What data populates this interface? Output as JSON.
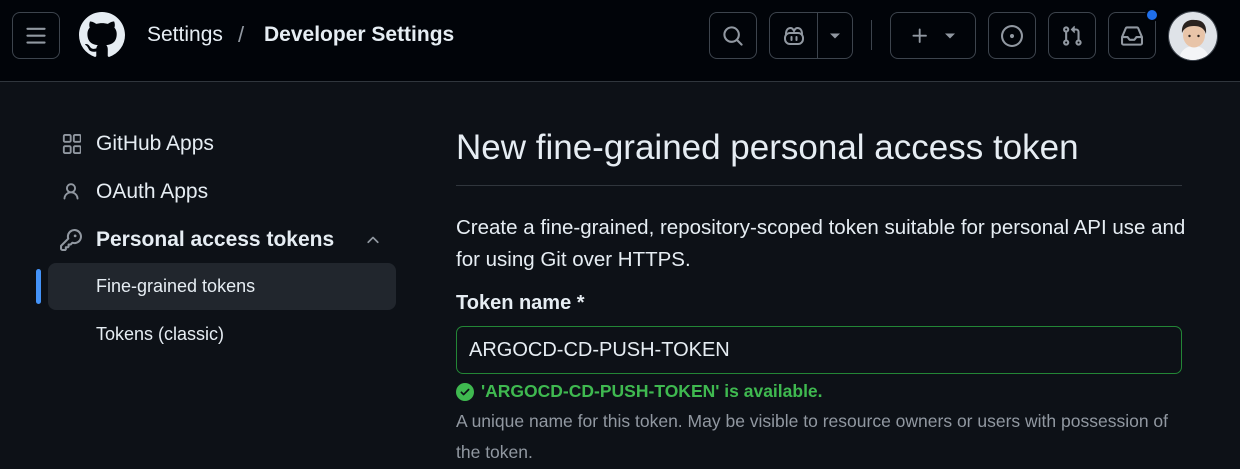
{
  "header": {
    "breadcrumb_settings": "Settings",
    "breadcrumb_separator": "/",
    "breadcrumb_current": "Developer Settings",
    "icons": [
      "hamburger-icon",
      "github-logo-icon",
      "search-icon",
      "copilot-icon",
      "chevron-down-icon",
      "plus-icon",
      "issue-opened-icon",
      "git-pull-request-icon",
      "inbox-icon"
    ],
    "has_notifications": true
  },
  "sidebar": {
    "items": [
      {
        "label": "GitHub Apps",
        "icon": "apps-icon"
      },
      {
        "label": "OAuth Apps",
        "icon": "person-icon"
      },
      {
        "label": "Personal access tokens",
        "icon": "key-icon",
        "expanded": true
      },
      {
        "label": "Fine-grained tokens",
        "selected": true
      },
      {
        "label": "Tokens (classic)"
      }
    ]
  },
  "main": {
    "title": "New fine-grained personal access token",
    "description": "Create a fine-grained, repository-scoped token suitable for personal API use and for using Git over HTTPS.",
    "token_name_label": "Token name *",
    "token_name_value": "ARGOCD-CD-PUSH-TOKEN",
    "availability_message": "'ARGOCD-CD-PUSH-TOKEN' is available.",
    "help_text": "A unique name for this token. May be visible to resource owners or users with possession of the token."
  },
  "colors": {
    "header_bg": "#010409",
    "page_bg": "#0d1117",
    "accent_blue": "#4493f8",
    "success_green": "#3fb950",
    "input_border_valid": "#238636",
    "notification_dot": "#1f6feb"
  }
}
